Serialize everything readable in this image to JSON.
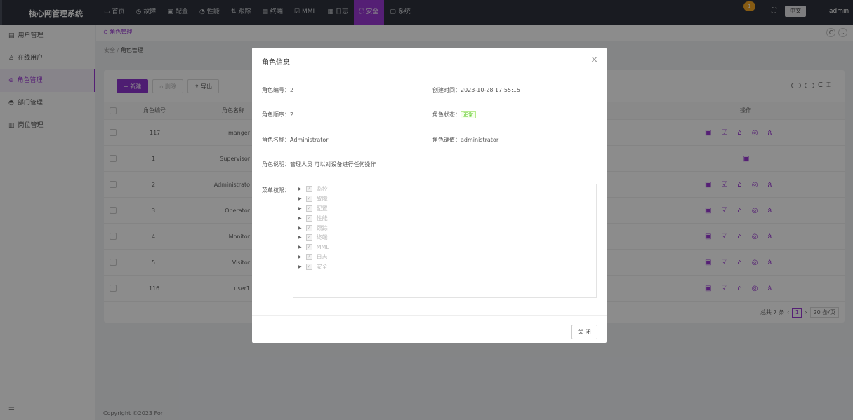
{
  "app": {
    "title": "核心网管理系统",
    "user": "admin",
    "lang": "中文",
    "notify_count": "1"
  },
  "menu": [
    {
      "label": "首页",
      "icon": "monitor-icon"
    },
    {
      "label": "故障",
      "icon": "clock-icon"
    },
    {
      "label": "配置",
      "icon": "config-icon"
    },
    {
      "label": "性能",
      "icon": "performance-icon"
    },
    {
      "label": "跟踪",
      "icon": "trace-icon"
    },
    {
      "label": "终端",
      "icon": "terminal-icon"
    },
    {
      "label": "MML",
      "icon": "mml-icon"
    },
    {
      "label": "日志",
      "icon": "log-icon"
    },
    {
      "label": "安全",
      "icon": "security-icon",
      "active": true
    },
    {
      "label": "系统",
      "icon": "system-icon"
    }
  ],
  "sidebar": {
    "items": [
      {
        "label": "用户管理"
      },
      {
        "label": "在线用户"
      },
      {
        "label": "角色管理",
        "active": true
      },
      {
        "label": "部门管理"
      },
      {
        "label": "岗位管理"
      }
    ]
  },
  "tab": {
    "label": "角色管理"
  },
  "breadcrumb": {
    "parent": "安全",
    "current": "角色管理"
  },
  "toolbar": {
    "new": "新建",
    "delete": "删除",
    "export": "导出"
  },
  "table": {
    "headers": [
      "角色编号",
      "角色名称",
      "操作"
    ],
    "rows": [
      {
        "id": "117",
        "name": "manger"
      },
      {
        "id": "1",
        "name": "Supervisor"
      },
      {
        "id": "2",
        "name": "Administrato"
      },
      {
        "id": "3",
        "name": "Operator"
      },
      {
        "id": "4",
        "name": "Monitor"
      },
      {
        "id": "5",
        "name": "Visitor"
      },
      {
        "id": "116",
        "name": "user1"
      }
    ]
  },
  "pager": {
    "total": "总共 7 条",
    "page": "1",
    "size": "20 条/页"
  },
  "footer": "Copyright ©2023 For",
  "modal": {
    "title": "角色信息",
    "role_id_label": "角色编号：",
    "role_id": "2",
    "created_label": "创建时间：",
    "created": "2023-10-28 17:55:15",
    "order_label": "角色顺序：",
    "order": "2",
    "status_label": "角色状态：",
    "status": "正常",
    "name_label": "角色名称：",
    "name": "Administrator",
    "key_label": "角色键值：",
    "key": "administrator",
    "desc_label": "角色说明：",
    "desc": "管理人员 可以对设备进行任何操作",
    "perm_label": "菜单权限：",
    "perms": [
      "监控",
      "故障",
      "配置",
      "性能",
      "跟踪",
      "终端",
      "MML",
      "日志",
      "安全"
    ],
    "close": "关 闭"
  }
}
